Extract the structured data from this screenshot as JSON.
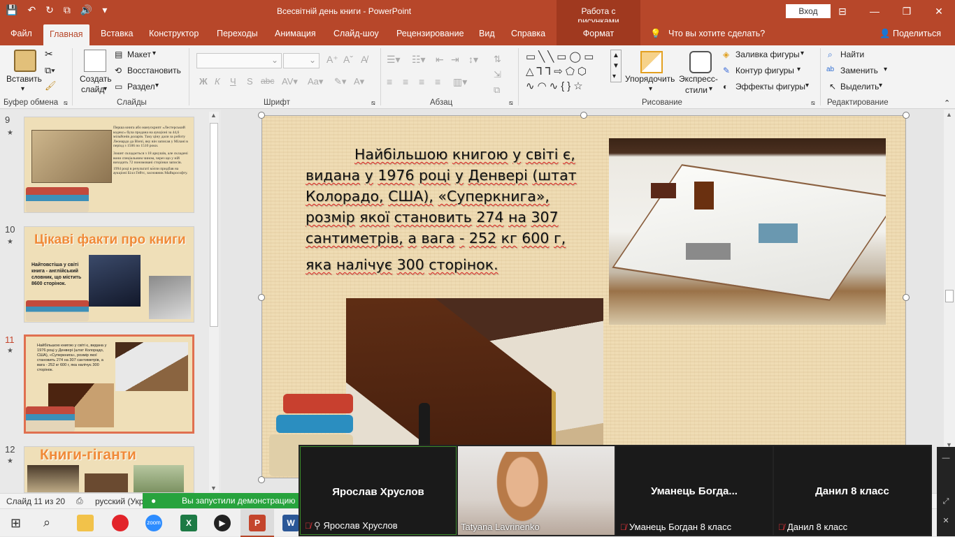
{
  "titlebar": {
    "doc_title": "Всесвітній день книги  -  PowerPoint",
    "context_tool": "Работа с рисунками",
    "signin": "Вход",
    "window_controls": {
      "minimize": "—",
      "restore": "❐",
      "close": "✕"
    }
  },
  "tabs": [
    "Файл",
    "Главная",
    "Вставка",
    "Конструктор",
    "Переходы",
    "Анимация",
    "Слайд-шоу",
    "Рецензирование",
    "Вид",
    "Справка",
    "Формат"
  ],
  "tell_me": "Что вы хотите сделать?",
  "share": "Поделиться",
  "ribbon": {
    "clipboard": {
      "paste": "Вставить",
      "label": "Буфер обмена"
    },
    "slides": {
      "new_slide_1": "Создать",
      "new_slide_2": "слайд",
      "layout": "Макет",
      "reset": "Восстановить",
      "section": "Раздел",
      "label": "Слайды"
    },
    "font": {
      "bold": "Ж",
      "italic": "К",
      "underline": "Ч",
      "strike": "S",
      "shadow": "abc",
      "label": "Шрифт"
    },
    "paragraph": {
      "label": "Абзац"
    },
    "drawing": {
      "arrange_1": "Упорядочить",
      "quick_1": "Экспресс-",
      "quick_2": "стили",
      "fill": "Заливка фигуры",
      "outline": "Контур фигуры",
      "effects": "Эффекты фигуры",
      "label": "Рисование"
    },
    "editing": {
      "find": "Найти",
      "replace": "Заменить",
      "select": "Выделить",
      "label": "Редактирование"
    }
  },
  "thumbnails": [
    {
      "num": "9",
      "title": "",
      "text": "Перша книга або манускрипт «Лестерський кодекс» була продана на аукціоні за 44,6 мільйонів доларів. Таку ціну дали за роботу Леонардо да Вінчі, яку він записав у Мілані в період з 1506 по 1510 роки.",
      "text2": "Зошит складається з 18 аркушів, але складені вони спеціальним чином, через що у ній виходить 72 пономовані сторінки записів.",
      "text3": "1994 році в результаті ко́пзи придбав на аукціоні Білл Гейтс, засновник Майкрософту."
    },
    {
      "num": "10",
      "title": "Цікаві факти про книги",
      "text": "Найтовстіша у світі книга - англійський словник, що містить 8600 сторінок."
    },
    {
      "num": "11",
      "title": "",
      "text": "Найбільшою книгою у світі є, видана у 1976 році у Денвері (штат Колорадо, США), «Суперкнига», розмір якої становить 274 на 307 сантиметрів, а вага - 252 кг 600 г, яка налічує 300 сторінок."
    },
    {
      "num": "12",
      "title": "Книги-гіганти",
      "text": ""
    }
  ],
  "slide": {
    "lines": [
      "Найбільшою книгою у світі є,",
      "видана у 1976 році у Денвері (штат",
      "Колорадо, США), «Суперкнига»,",
      "розмір якої становить 274 на 307",
      "сантиметрів, а вага - 252 кг 600 г,"
    ],
    "last_line": "яка налічує 300 сторінок."
  },
  "status": {
    "slide_counter": "Слайд 11 из 20",
    "language": "русский (Укр",
    "share_notice": "Вы запустили демонстрацию"
  },
  "video": [
    {
      "name": "Ярослав Хруслов",
      "label": "Ярослав Хруслов",
      "muted": true
    },
    {
      "name": "",
      "label": "Tatyana Lavrinenko",
      "muted": false
    },
    {
      "name": "Уманець  Богда...",
      "label": "Уманець Богдан 8 класс",
      "muted": true
    },
    {
      "name": "Данил 8 класс",
      "label": "Данил 8 класс",
      "muted": true
    }
  ],
  "colors": {
    "accent": "#b7472a",
    "zoom_green": "#27a33d",
    "slide_bg": "#efdcb4"
  }
}
